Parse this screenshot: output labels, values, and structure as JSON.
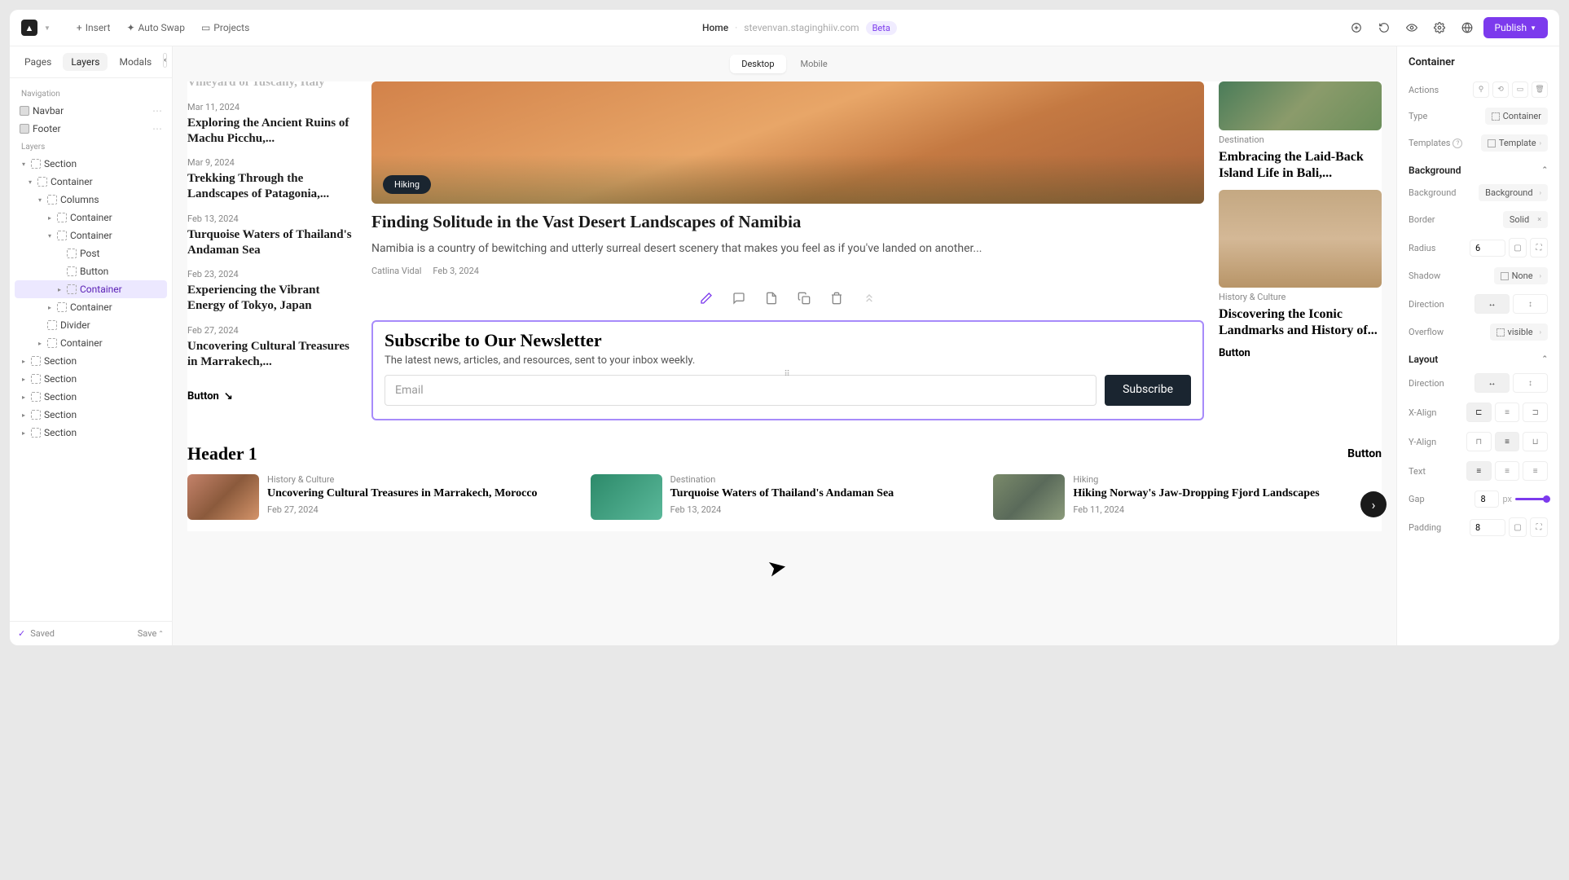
{
  "topbar": {
    "insert": "Insert",
    "autoswap": "Auto Swap",
    "projects": "Projects",
    "home": "Home",
    "domain": "stevenvan.staginghiiv.com",
    "beta": "Beta",
    "publish": "Publish"
  },
  "left": {
    "tabs": [
      "Pages",
      "Layers",
      "Modals"
    ],
    "nav_label": "Navigation",
    "nav_items": [
      "Navbar",
      "Footer"
    ],
    "layers_label": "Layers",
    "tree": [
      {
        "label": "Section",
        "depth": 0,
        "caret": "▾"
      },
      {
        "label": "Container",
        "depth": 1,
        "caret": "▾"
      },
      {
        "label": "Columns",
        "depth": 2,
        "caret": "▾"
      },
      {
        "label": "Container",
        "depth": 3,
        "caret": "▸"
      },
      {
        "label": "Container",
        "depth": 3,
        "caret": "▾"
      },
      {
        "label": "Post",
        "depth": 4,
        "caret": ""
      },
      {
        "label": "Button",
        "depth": 4,
        "caret": ""
      },
      {
        "label": "Container",
        "depth": 4,
        "caret": "▸",
        "selected": true
      },
      {
        "label": "Container",
        "depth": 3,
        "caret": "▸"
      },
      {
        "label": "Divider",
        "depth": 2,
        "caret": ""
      },
      {
        "label": "Container",
        "depth": 2,
        "caret": "▸"
      },
      {
        "label": "Section",
        "depth": 0,
        "caret": "▸"
      },
      {
        "label": "Section",
        "depth": 0,
        "caret": "▸"
      },
      {
        "label": "Section",
        "depth": 0,
        "caret": "▸"
      },
      {
        "label": "Section",
        "depth": 0,
        "caret": "▸"
      },
      {
        "label": "Section",
        "depth": 0,
        "caret": "▸"
      }
    ],
    "saved": "Saved",
    "save": "Save"
  },
  "device": {
    "desktop": "Desktop",
    "mobile": "Mobile"
  },
  "content": {
    "col_left": [
      {
        "date": "",
        "title": "Vineyard of Tuscany, Italy"
      },
      {
        "date": "Mar 11, 2024",
        "title": "Exploring the Ancient Ruins of Machu Picchu,..."
      },
      {
        "date": "Mar 9, 2024",
        "title": "Trekking Through the Landscapes of Patagonia,..."
      },
      {
        "date": "Feb 13, 2024",
        "title": "Turquoise Waters of Thailand's Andaman Sea"
      },
      {
        "date": "Feb 23, 2024",
        "title": "Experiencing the Vibrant Energy of Tokyo, Japan"
      },
      {
        "date": "Feb 27, 2024",
        "title": "Uncovering Cultural Treasures in Marrakech,..."
      }
    ],
    "left_btn": "Button",
    "hero": {
      "badge": "Hiking",
      "title": "Finding Solitude in the Vast Desert Landscapes of Namibia",
      "desc": "Namibia is a country of bewitching and utterly surreal desert scenery that makes you feel as if you've landed on another...",
      "author": "Catlina Vidal",
      "date": "Feb 3, 2024"
    },
    "newsletter": {
      "title": "Subscribe to Our Newsletter",
      "sub": "The latest news, articles, and resources, sent to your inbox weekly.",
      "placeholder": "Email",
      "btn": "Subscribe"
    },
    "col_right": [
      {
        "cat": "Destination",
        "title": "Embracing the Laid-Back Island Life in Bali,..."
      },
      {
        "cat": "History & Culture",
        "title": "Discovering the Iconic Landmarks and History of..."
      }
    ],
    "right_btn": "Button",
    "lower_header": "Header 1",
    "lower_btn": "Button",
    "cards": [
      {
        "cat": "History & Culture",
        "title": "Uncovering Cultural Treasures in Marrakech, Morocco",
        "date": "Feb 27, 2024"
      },
      {
        "cat": "Destination",
        "title": "Turquoise Waters of Thailand's Andaman Sea",
        "date": "Feb 13, 2024"
      },
      {
        "cat": "Hiking",
        "title": "Hiking Norway's Jaw-Dropping Fjord Landscapes",
        "date": "Feb 11, 2024"
      }
    ]
  },
  "props": {
    "panel": "Container",
    "actions": "Actions",
    "type_label": "Type",
    "type_val": "Container",
    "templates_label": "Templates",
    "templates_val": "Template",
    "bg_section": "Background",
    "bg_label": "Background",
    "bg_val": "Background",
    "border_label": "Border",
    "border_val": "Solid",
    "radius_label": "Radius",
    "radius_val": "6",
    "shadow_label": "Shadow",
    "shadow_val": "None",
    "direction_label": "Direction",
    "overflow_label": "Overflow",
    "overflow_val": "visible",
    "layout_section": "Layout",
    "xalign": "X-Align",
    "yalign": "Y-Align",
    "text": "Text",
    "gap_label": "Gap",
    "gap_val": "8",
    "gap_unit": "px",
    "padding_label": "Padding",
    "padding_val": "8"
  }
}
